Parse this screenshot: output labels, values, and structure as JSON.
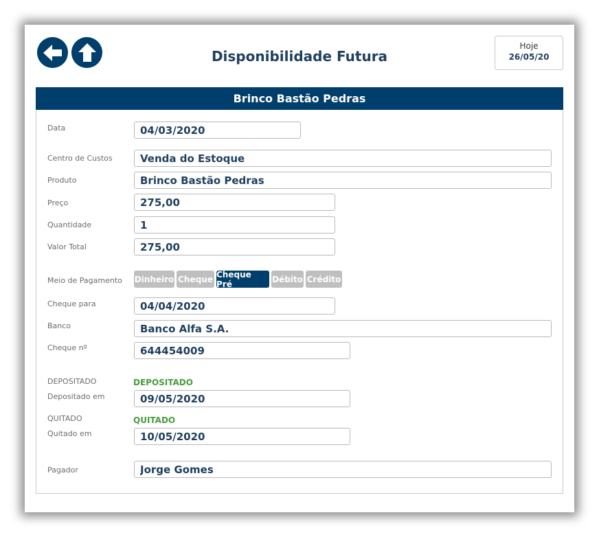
{
  "header": {
    "title": "Disponibilidade Futura",
    "today_label": "Hoje",
    "today_date": "26/05/20"
  },
  "product_header": "Brinco Bastão Pedras",
  "form": {
    "data": {
      "label": "Data",
      "value": "04/03/2020"
    },
    "centro_custos": {
      "label": "Centro de Custos",
      "value": "Venda do Estoque"
    },
    "produto": {
      "label": "Produto",
      "value": "Brinco Bastão Pedras"
    },
    "preco": {
      "label": "Preço",
      "value": "275,00"
    },
    "quantidade": {
      "label": "Quantidade",
      "value": "1"
    },
    "valor_total": {
      "label": "Valor Total",
      "value": "275,00"
    },
    "meio_pagamento": {
      "label": "Meio de Pagamento",
      "options": [
        "Dinheiro",
        "Cheque",
        "Cheque Pré",
        "Débito",
        "Crédito"
      ],
      "selected": "Cheque Pré"
    },
    "cheque_para": {
      "label": "Cheque para",
      "value": "04/04/2020"
    },
    "banco": {
      "label": "Banco",
      "value": "Banco Alfa S.A."
    },
    "cheque_no": {
      "label": "Cheque nº",
      "value": "644454009"
    },
    "depositado": {
      "label": "DEPOSITADO",
      "status": "DEPOSITADO"
    },
    "depositado_em": {
      "label": "Depositado em",
      "value": "09/05/2020"
    },
    "quitado": {
      "label": "QUITADO",
      "status": "QUITADO"
    },
    "quitado_em": {
      "label": "Quitado em",
      "value": "10/05/2020"
    },
    "pagador": {
      "label": "Pagador",
      "value": "Jorge Gomes"
    }
  },
  "colors": {
    "primary": "#003f6b",
    "status_green": "#4a9a3e",
    "inactive_button": "#bfbfbf"
  },
  "icons": {
    "back": "arrow-left-icon",
    "home": "arrow-up-icon"
  }
}
